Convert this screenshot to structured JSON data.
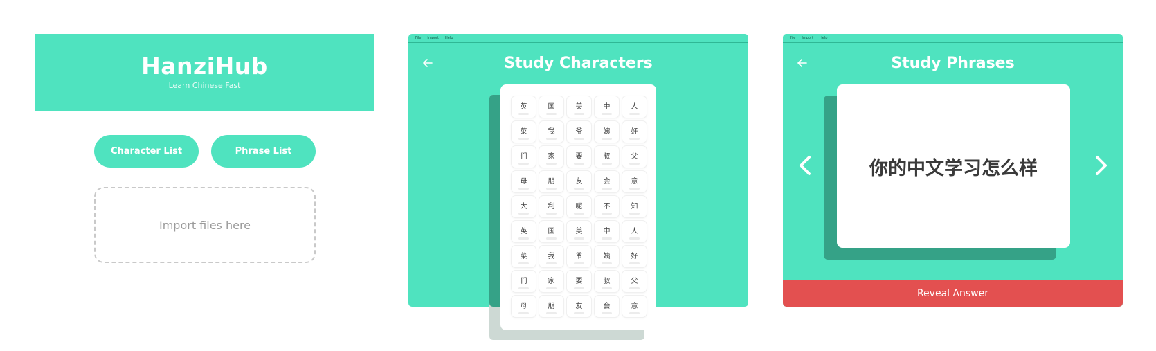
{
  "home": {
    "title": "HanziHub",
    "subtitle": "Learn Chinese Fast",
    "character_list_label": "Character List",
    "phrase_list_label": "Phrase List",
    "import_label": "Import files here"
  },
  "menu": [
    "File",
    "Import",
    "Help"
  ],
  "characters_screen": {
    "title": "Study Characters",
    "rows": [
      [
        "英",
        "国",
        "美",
        "中",
        "人"
      ],
      [
        "菜",
        "我",
        "爷",
        "姨",
        "好"
      ],
      [
        "们",
        "家",
        "要",
        "叔",
        "父"
      ],
      [
        "母",
        "朋",
        "友",
        "会",
        "意"
      ],
      [
        "大",
        "利",
        "呢",
        "不",
        "知"
      ],
      [
        "英",
        "国",
        "美",
        "中",
        "人"
      ],
      [
        "菜",
        "我",
        "爷",
        "姨",
        "好"
      ],
      [
        "们",
        "家",
        "要",
        "叔",
        "父"
      ],
      [
        "母",
        "朋",
        "友",
        "会",
        "意"
      ]
    ]
  },
  "phrases_screen": {
    "title": "Study Phrases",
    "phrase": "你的中文学习怎么样",
    "reveal_label": "Reveal Answer"
  },
  "icons": {
    "back": "arrow-left-icon",
    "prev": "chevron-left-icon",
    "next": "chevron-right-icon"
  },
  "colors": {
    "accent": "#4fe3bf",
    "accent_dark": "#35a287",
    "reveal": "#e35050"
  }
}
